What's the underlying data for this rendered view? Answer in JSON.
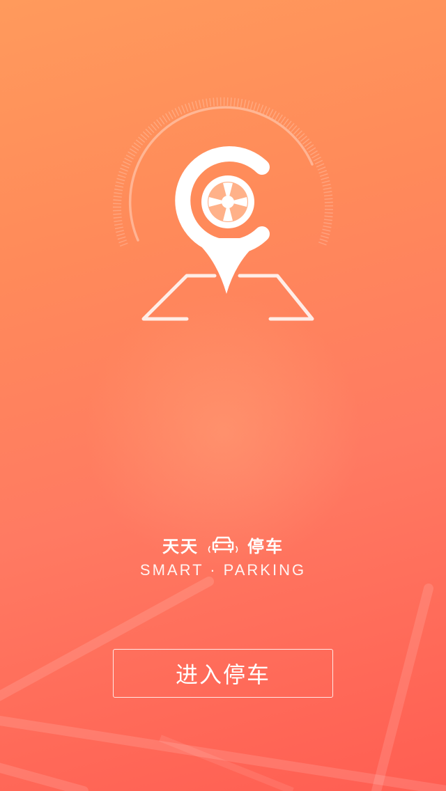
{
  "splash": {
    "brand_left": "天天",
    "brand_right": "停车",
    "tagline": "SMART · PARKING",
    "enter_button_label": "进入停车"
  },
  "colors": {
    "gradient_top": "#ff9a5c",
    "gradient_bottom": "#ff5e52",
    "foreground": "#ffffff"
  },
  "icons": {
    "logo": "location-pin-wheel-icon",
    "brand_car": "car-icon"
  }
}
